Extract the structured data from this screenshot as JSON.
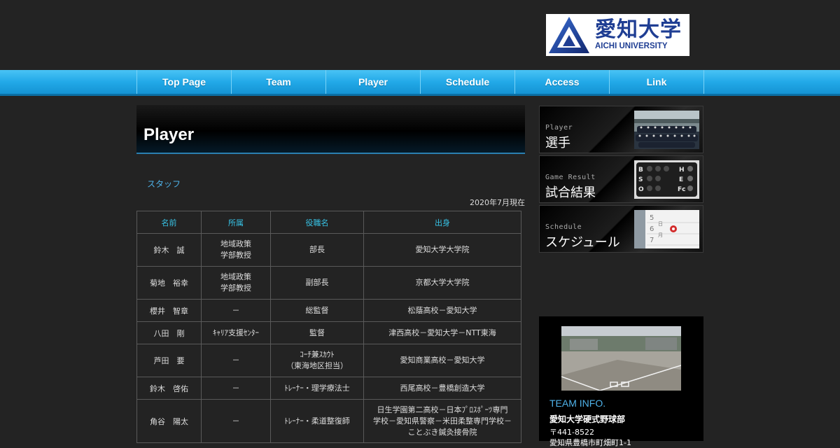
{
  "header": {
    "logo_jp": "愛知大学",
    "logo_en": "AICHI UNIVERSITY"
  },
  "nav": {
    "items": [
      {
        "label": "Top Page"
      },
      {
        "label": "Team"
      },
      {
        "label": "Player"
      },
      {
        "label": "Schedule"
      },
      {
        "label": "Access"
      },
      {
        "label": "Link"
      }
    ]
  },
  "main": {
    "title": "Player",
    "section": "スタッフ",
    "as_of": "2020年7月現在",
    "columns": [
      "名前",
      "所属",
      "役職名",
      "出身"
    ],
    "rows": [
      {
        "name": "鈴木　誠",
        "affil": [
          "地域政策",
          "学部教授"
        ],
        "role": [
          "部長"
        ],
        "origin": [
          "愛知大学大学院"
        ]
      },
      {
        "name": "菊地　裕幸",
        "affil": [
          "地域政策",
          "学部教授"
        ],
        "role": [
          "副部長"
        ],
        "origin": [
          "京都大学大学院"
        ]
      },
      {
        "name": "櫻井　智章",
        "affil": [
          "－"
        ],
        "role": [
          "総監督"
        ],
        "origin": [
          "松蔭高校－愛知大学"
        ]
      },
      {
        "name": "八田　剛",
        "affil": [
          "ｷｬﾘｱ支援ｾﾝﾀｰ"
        ],
        "role": [
          "監督"
        ],
        "origin": [
          "津西高校－愛知大学－NTT東海"
        ]
      },
      {
        "name": "芦田　要",
        "affil": [
          "－"
        ],
        "role": [
          "ｺｰﾁ兼ｽｶｳﾄ",
          "（東海地区担当）"
        ],
        "origin": [
          "愛知商業高校－愛知大学"
        ]
      },
      {
        "name": "鈴木　啓佑",
        "affil": [
          "－"
        ],
        "role": [
          "ﾄﾚｰﾅｰ・理学療法士"
        ],
        "origin": [
          "西尾高校－豊橋創造大学"
        ]
      },
      {
        "name": "角谷　陽太",
        "affil": [
          "－"
        ],
        "role": [
          "ﾄﾚｰﾅｰ・柔道整復師"
        ],
        "origin": [
          "日生学園第二高校－日本ﾌﾟﾛｽﾎﾟｰﾂ専門",
          "学校－愛知県警察－米田柔整専門学校－",
          "ことぶき鍼灸接骨院"
        ]
      }
    ]
  },
  "sidebar": {
    "banners": [
      {
        "en": "Player",
        "jp": "選手"
      },
      {
        "en": "Game Result",
        "jp": "試合結果"
      },
      {
        "en": "Schedule",
        "jp": "スケジュール"
      }
    ],
    "scoreboard_letters": [
      "B",
      "S",
      "O",
      "H",
      "E",
      "Fc"
    ],
    "team_info": {
      "label": "TEAM INFO.",
      "name": "愛知大学硬式野球部",
      "zip": "〒441-8522",
      "address": "愛知県豊橋市町畑町1-1"
    }
  },
  "colors": {
    "background": "#232323",
    "nav_blue": "#22a9e8",
    "accent_cyan": "#37c3e6",
    "link_blue": "#4fb3ea",
    "logo_navy": "#1f3e93"
  }
}
